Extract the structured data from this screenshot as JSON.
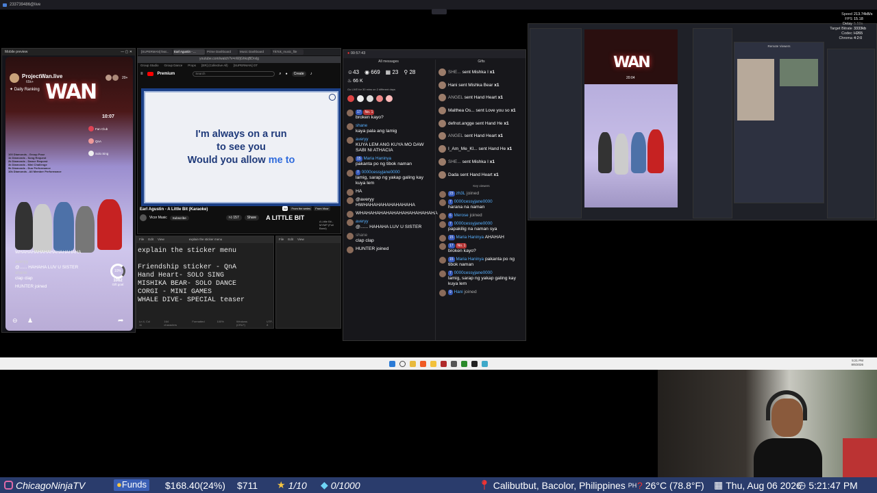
{
  "topbar": {
    "title": "233739486@live"
  },
  "mobile": {
    "window_title": "Mobile preview",
    "profile_name": "ProjectWan.live",
    "likes": "65k+",
    "daily_ranking": "Daily Ranking",
    "viewer_count": "20+",
    "timer": "10:07",
    "menu_items": [
      "Fan Club",
      "QnA",
      "Solo Sing"
    ],
    "gift_menu": [
      "100 Diamonds - Group Pose",
      "1k Diamonds - Song Request",
      "2k Diamonds - Dance Request",
      "3k Diamonds - Mini Challenge",
      "5k Diamonds - Duo Performance",
      "10k Diamonds - All Member Performance"
    ],
    "chat": [
      "WHAHAHAHAHAHAHAHAHAHA",
      "averyy",
      "@...... HAHAHA LUV U SISTER",
      "shane",
      "clap clap",
      "HUNTER joined"
    ],
    "gift_goal_pct": "10%",
    "gift_goal_count": "1062",
    "gift_goal_label": "Gift goal"
  },
  "browser": {
    "tabs": [
      "[SUPERMAN] feat...",
      "Earl Agustin - ...",
      "Prime Dashboard",
      "Music Dashboard",
      "TikTok_music_file"
    ],
    "url": "youtube.com/watch?v=nWjGhkqBDrxlg",
    "bookmarks": [
      "Group Studio",
      "Group Dance",
      "Props",
      "[ER] (Collective All)",
      "[SUPERMAN] OT"
    ],
    "brand": "Premium",
    "search_placeholder": "Search",
    "create_label": "Create",
    "lyrics": [
      "I'm always on a run",
      "to see you",
      "Would you allow "
    ],
    "lyric_highlight": "me to",
    "video_title": "Earl Agustin - A Little Bit (Karaoke)",
    "channel": "Vicor Music",
    "subscribe": "Subscribe",
    "likes": "157",
    "share": "Share",
    "chips": [
      "All",
      "From the series",
      "From Vicor"
    ],
    "thumb_title": "A LITTLE BIT",
    "thumb_subtitle": "A Little Bit - MYMP (Full Band)"
  },
  "notepad": {
    "menu": [
      "File",
      "Edit",
      "View"
    ],
    "tab_title": "explain the sticker menu",
    "lines": [
      "explain the sticker menu",
      "",
      "Friendship sticker - QnA",
      "Hand Heart- SOLO SING",
      "MISHIKA BEAR- SOLO DANCE",
      "CORGI - MINI GAMES",
      "WHALE DIVE- SPECIAL teaser"
    ],
    "status": [
      "Ln 4, Col 11",
      "164 characters",
      "Formatted",
      "100%",
      "Windows (CRLF)",
      "UTF-8"
    ]
  },
  "chat": {
    "time": "00:57:43",
    "all_messages": "All messages",
    "gifts_header": "Gifts",
    "stats": {
      "viewers": "43",
      "likes": "669",
      "members": "23",
      "shares": "28",
      "coins": "66 K"
    },
    "goal_text": "Go LIVE for 30 mins on 2 different days",
    "left_messages": [
      {
        "user": "",
        "badge": "17",
        "text": "broken kayo?"
      },
      {
        "user": "shane",
        "badge": "",
        "text": "kaya pala ang lamig"
      },
      {
        "user": "averyy",
        "badge": "",
        "text": "KUYA LEM ANG KUYA MO DAW SABI NI ATHACIA"
      },
      {
        "user": "Maria Haninya",
        "badge": "15",
        "text": "pakanta po ng tibok naman"
      },
      {
        "user": "0000cessyjane0000",
        "badge": "7",
        "text": "lamig, sarap ng yakap galing kay kuya lem"
      },
      {
        "user": "",
        "badge": "",
        "text": "HA"
      },
      {
        "user": "",
        "badge": "",
        "text": "@averyy HWHAHAHAHAHAHAHAHA"
      },
      {
        "user": "",
        "badge": "",
        "text": "WHAHAHAHAHAHAHAHAHAHAHAHA"
      },
      {
        "user": "averyy",
        "badge": "",
        "text": "@...... HAHAHA LUV U SISTER"
      },
      {
        "user": "shane",
        "badge": "",
        "text": "clap clap"
      },
      {
        "user": "HUNTER",
        "badge": "",
        "text": "joined"
      }
    ],
    "gifts": [
      {
        "user": "SHE...",
        "text": "sent Mishka I",
        "mult": "x1"
      },
      {
        "user": "Hani",
        "text": "sent Mishka Bear",
        "mult": "x1"
      },
      {
        "user": "ANGEL",
        "text": "sent Hand Heart",
        "mult": "x1"
      },
      {
        "user": "Malthea Os...",
        "text": "sent Love you so",
        "mult": "x1"
      },
      {
        "user": "defnot.angge",
        "text": "sent Hand He",
        "mult": "x1"
      },
      {
        "user": "ANGEL",
        "text": "sent Hand Heart",
        "mult": "x1"
      },
      {
        "user": "I_Am_Me_Kl...",
        "text": "sent Hand He",
        "mult": "x1"
      },
      {
        "user": "SHE...",
        "text": "sent Mishka I",
        "mult": "x1"
      },
      {
        "user": "Dada",
        "text": "sent Hand Heart",
        "mult": "x1"
      }
    ],
    "key_viewers": "Key viewers",
    "right_messages": [
      {
        "user": "zh3L",
        "badge": "23",
        "text": "joined"
      },
      {
        "user": "0000cessyjane0000",
        "badge": "7",
        "text": "harana na naman"
      },
      {
        "user": "Merose",
        "badge": "6",
        "text": "joined"
      },
      {
        "user": "0000cessyjane0000",
        "badge": "7",
        "text": "papakilig na naman sya"
      },
      {
        "user": "Maria Haninya",
        "badge": "15",
        "text": "AHAHAH"
      },
      {
        "user": "",
        "badge": "17",
        "text": "broken kayo?"
      },
      {
        "user": "Maria Haninya",
        "badge": "15",
        "text": "pakanta po ng tibok naman"
      },
      {
        "user": "0000cessyjane0000",
        "badge": "7",
        "text": "lamig, sarap ng yakap galing kay kuya lem"
      },
      {
        "user": "Hani",
        "badge": "9",
        "text": "joined"
      }
    ]
  },
  "obs": {
    "timer": "20:04",
    "remote_label": "Remote Viewers"
  },
  "stream_stats": {
    "labels": [
      "Speed",
      "FPS",
      "Delay",
      "Target Bitrate",
      "Codec",
      "Chroma"
    ],
    "values": [
      "213.74kB/s",
      "15.18",
      "5.59s",
      "3333kb",
      "H265",
      "4:2:0"
    ]
  },
  "taskbar": {
    "time": "5:21 PM",
    "date": "8/6/2026"
  },
  "bottom": {
    "channel": "ChicagoNinjaTV",
    "funds_label": "Funds",
    "funds_value": "$168.40(24%)",
    "amount": "$711",
    "stars": "1/10",
    "diamonds": "0/1000",
    "location": "Calibutbut, Bacolor, Philippines",
    "country": "PH",
    "weather": "26°C (78.8°F)",
    "date": "Thu, Aug 06 2026",
    "time": "5:21:47 PM"
  },
  "colors": {
    "bottom_bar": "#2a3c6c",
    "funds_bg": "#3a5fb5",
    "lyric_blue": "#1f3a7a",
    "lyric_highlight": "#2f6bdc"
  }
}
